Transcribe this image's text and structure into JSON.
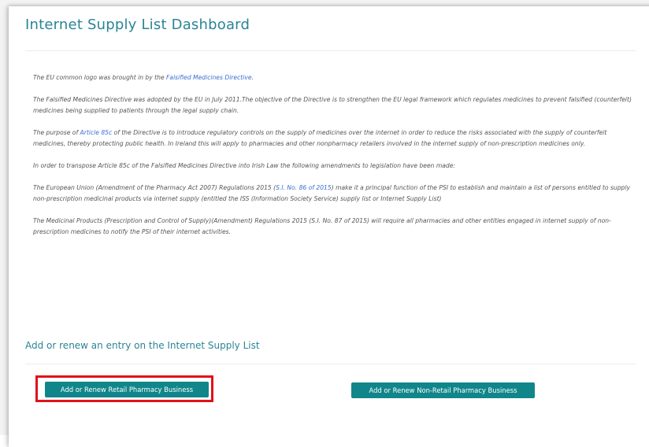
{
  "page": {
    "title": "Internet Supply List Dashboard"
  },
  "content": {
    "p1": {
      "pre": "The EU common logo was brought in by the ",
      "link": "Falsified Medicines Directive",
      "post": "."
    },
    "p2": "The Falsified Medicines Directive was adopted by the EU in July 2011.The objective of the Directive is to strengthen the EU legal framework which regulates medicines to prevent falsified (counterfeit) medicines being supplied to patients through the legal supply chain.",
    "p3": {
      "pre": "The purpose of ",
      "link": "Article 85c",
      "post": " of the Directive is to introduce regulatory controls on the supply of medicines over the internet in order to reduce the risks associated with the supply of counterfeit medicines, thereby protecting public health. In Ireland this will apply to pharmacies and other nonpharmacy retailers involved in the internet supply of non-prescription medicines only."
    },
    "p4": "In order to transpose Article 85c of the Falsified Medicines Directive into Irish Law the following amendments to legislation have been made:",
    "p5": {
      "pre": "The European Union (Amendment of the Pharmacy Act 2007) Regulations 2015 (",
      "link": "S.I. No. 86 of 2015",
      "post": ") make it a principal function of the PSI to establish and maintain a list of persons entitled to supply non-prescription medicinal products via internet supply (entitled the ISS (Information Society Service) supply list or Internet Supply List)"
    },
    "p6": "The Medicinal Products (Prescription and Control of Supply)(Amendment) Regulations 2015 (S.I. No. 87 of 2015) will require all pharmacies and other entities engaged in internet supply of non-prescription medicines to notify the PSI of their internet activities."
  },
  "section": {
    "heading": "Add or renew an entry on the Internet Supply List"
  },
  "buttons": {
    "retail": "Add or Renew Retail Pharmacy Business",
    "non_retail": "Add or Renew Non-Retail Pharmacy Business"
  },
  "colors": {
    "accent": "#2a8496",
    "button": "#10868b",
    "highlight": "#e0121b",
    "link": "#3a6fd1"
  }
}
